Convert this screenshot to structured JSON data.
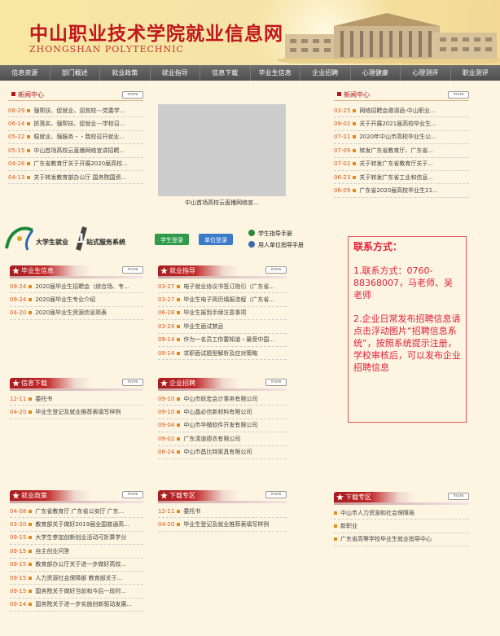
{
  "banner": {
    "title": "中山职业技术学院就业信息网",
    "subtitle": "ZHONGSHAN POLYTECHNIC"
  },
  "nav": [
    "信息资源",
    "部门概述",
    "就业政策",
    "就业指导",
    "信息下载",
    "毕业生信息",
    "企业招聘",
    "心理健康",
    "心理测评",
    "职业测评"
  ],
  "more_label": "more",
  "news_left": {
    "title": "新闻中心",
    "items": [
      {
        "date": "08-29",
        "text": "强帮扶、促就业、迎宾校---党委学..."
      },
      {
        "date": "06-14",
        "text": "抓落实、强帮扶、促就业---学校召..."
      },
      {
        "date": "05-22",
        "text": "稳就业、强服务・・我校召开就业..."
      },
      {
        "date": "05-15",
        "text": "中山首场高校云直播网络宣讲招聘..."
      },
      {
        "date": "04-28",
        "text": "广东省教育厅关于开展2020届高校..."
      },
      {
        "date": "04-13",
        "text": "关于转发教育部办公厅 国务院国资..."
      }
    ]
  },
  "news_image_caption": "中山首场高校云直播网络宣...",
  "news_right": {
    "title": "新闻中心",
    "items": [
      {
        "date": "03-25",
        "text": "网络招聘会邀请函-中山职业..."
      },
      {
        "date": "09-02",
        "text": "关于开展2021届高校毕业生..."
      },
      {
        "date": "07-21",
        "text": "2020年中山市高校毕业生公..."
      },
      {
        "date": "07-09",
        "text": "转发广东省教育厅、广东省..."
      },
      {
        "date": "07-02",
        "text": "关于转发广东省教育厅关于..."
      },
      {
        "date": "06-23",
        "text": "关于转发广东省工业和信息..."
      },
      {
        "date": "06-09",
        "text": "广东省2020届高校毕业生21..."
      }
    ]
  },
  "service": {
    "title": "大学生就业",
    "num": "1",
    "suffix": "站式服务系统",
    "student_login": "学生登录",
    "unit_login": "单位登录",
    "student_manual": "学生指导手册",
    "employer_manual": "用人单位指导手册"
  },
  "graduate": {
    "title": "毕业生信息",
    "items": [
      {
        "date": "09-24",
        "text": "2020届毕业生招聘会（综合场、专..."
      },
      {
        "date": "09-24",
        "text": "2020届毕业生专业介绍"
      },
      {
        "date": "04-20",
        "text": "2020届毕业生资源信息简表"
      }
    ]
  },
  "guide": {
    "title": "就业指导",
    "items": [
      {
        "date": "03-27",
        "text": "电子就业协议书签订指引（广东省..."
      },
      {
        "date": "03-27",
        "text": "毕业生电子简历填报流程（广东省..."
      },
      {
        "date": "06-28",
        "text": "毕业生报到手续注意事项"
      },
      {
        "date": "03-24",
        "text": "毕业生面试禁忌"
      },
      {
        "date": "09-14",
        "text": "作为一名员工你要知道・最受中国..."
      },
      {
        "date": "09-14",
        "text": "求职面试题型解析及应对策略"
      }
    ]
  },
  "download": {
    "title": "信息下载",
    "items": [
      {
        "date": "12-11",
        "text": "委托书"
      },
      {
        "date": "04-20",
        "text": "毕业生登记及就业推荐表填写样例"
      }
    ]
  },
  "recruit": {
    "title": "企业招聘",
    "items": [
      {
        "date": "09-10",
        "text": "中山市跃宏会计事务有限公司"
      },
      {
        "date": "09-10",
        "text": "中山晶必信新材料有限公司"
      },
      {
        "date": "09-04",
        "text": "中山市华楷软件开发有限公司"
      },
      {
        "date": "09-02",
        "text": "广东清道德衣有限公司"
      },
      {
        "date": "08-24",
        "text": "中山市昌比特家具有限公司"
      }
    ]
  },
  "contact": {
    "heading": "联系方式：",
    "p1": "1.联系方式：0760-88368007，马老师、吴老师",
    "p2": "2.企业日常发布招聘信息请点击浮动图片“招聘信息系统”，按照系统提示注册，学校审核后，可以发布企业招聘信息"
  },
  "policy": {
    "title": "就业政策",
    "items": [
      {
        "date": "04-08",
        "text": "广东省教育厅 广东省公安厅 广东..."
      },
      {
        "date": "03-20",
        "text": "教育部关于做好2019届全国普通高..."
      },
      {
        "date": "09-15",
        "text": "大学生参加创新创业活动可折算学分"
      },
      {
        "date": "09-15",
        "text": "自主创业问答"
      },
      {
        "date": "09-15",
        "text": "教育部办公厅关于进一步做好高校..."
      },
      {
        "date": "09-15",
        "text": "人力资源社会保障部 教育部关于..."
      },
      {
        "date": "09-15",
        "text": "国务院关于做好当前和今后一段时..."
      },
      {
        "date": "09-14",
        "text": "国务院关于进一步实施创新驱动发展..."
      }
    ]
  },
  "zone_mid": {
    "title": "下载专区",
    "items": [
      {
        "date": "12-11",
        "text": "委托书"
      },
      {
        "date": "04-20",
        "text": "毕业生登记及就业推荐表填写样例"
      }
    ]
  },
  "zone_right": {
    "title": "下载专区",
    "items": [
      {
        "date": "",
        "text": "中山市人力资源和社会保障局"
      },
      {
        "date": "",
        "text": "新职业"
      },
      {
        "date": "",
        "text": "广东省高等学校毕业生就业指导中心"
      }
    ]
  }
}
